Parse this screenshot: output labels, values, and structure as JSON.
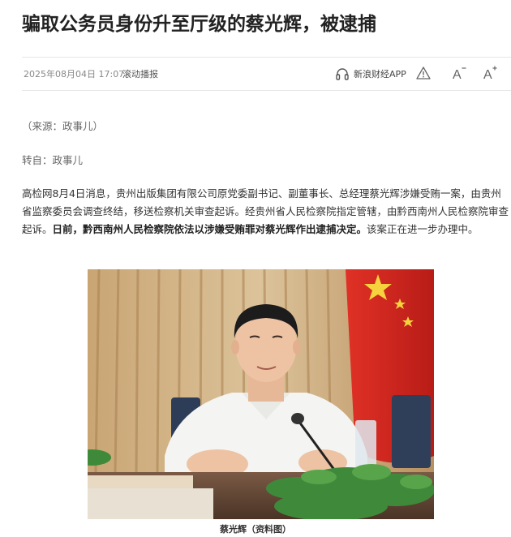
{
  "article": {
    "title": "骗取公务员身份升至厅级的蔡光辉，被逮捕",
    "source": "（来源：政事儿）",
    "reprint": "转自：政事儿",
    "paragraph_part1": "高检网8月4日消息，贵州出版集团有限公司原党委副书记、副董事长、总经理蔡光辉涉嫌受贿一案，由贵州省监察委员会调查终结，移送检察机关审查起诉。经贵州省人民检察院指定管辖，由黔西南州人民检察院审查起诉。",
    "paragraph_bold": "日前，黔西南州人民检察院依法以涉嫌受贿罪对蔡光辉作出逮捕决定。",
    "paragraph_part2": "该案正在进一步办理中。",
    "photo_caption": "蔡光辉（资料图）"
  },
  "meta": {
    "date": "2025年08月04日 17:07",
    "channel": "滚动播报",
    "app_label": "新浪财经APP",
    "icons": [
      "headphones-icon",
      "warning-icon",
      "font-decrease-icon",
      "font-increase-icon"
    ],
    "decrease_letter": "A",
    "increase_letter": "A"
  },
  "colors": {
    "title": "#222222",
    "text": "#333333",
    "meta": "#888888",
    "divider": "#e6e6e6",
    "flag_red": "#d5281f",
    "flag_star": "#f6d23e"
  }
}
